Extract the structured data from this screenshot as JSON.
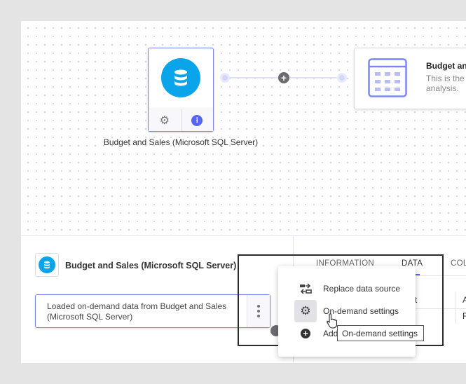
{
  "canvas": {
    "source_node": {
      "label": "Budget and Sales (Microsoft SQL Server)",
      "icon": "database-icon"
    },
    "target_card": {
      "title": "Budget and Sales",
      "description": "This is the analysis."
    },
    "connector_add": "+"
  },
  "details": {
    "source_title": "Budget and Sales (Microsoft SQL Server)",
    "step_text": "Loaded on-demand data from Budget and Sales (Microsoft SQL Server)"
  },
  "tabs": [
    {
      "label": "INFORMATION"
    },
    {
      "label": "DATA",
      "active": true
    },
    {
      "label": "COLUMNS"
    }
  ],
  "table_partial": {
    "header": "t",
    "col2_header": "A",
    "col2_cell": "F"
  },
  "menu": {
    "items": [
      {
        "label": "Replace data source",
        "icon": "replace-icon"
      },
      {
        "label": "On-demand settings",
        "icon": "gear-icon"
      },
      {
        "label": "Add",
        "icon": "add-circle-icon"
      }
    ]
  },
  "tooltip": "On-demand settings",
  "colors": {
    "accent": "#5865f2",
    "db_blue": "#0aa4ea",
    "border_accent": "#7b86f2"
  }
}
